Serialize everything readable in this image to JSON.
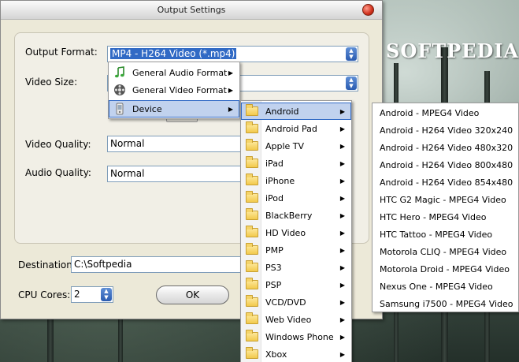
{
  "window": {
    "title": "Output Settings"
  },
  "watermark": {
    "brand": "SOFTPEDIA",
    "mark": "®"
  },
  "form": {
    "output_format_label": "Output Format:",
    "output_format_value": "MP4 - H264 Video (*.mp4)",
    "video_size_label": "Video Size:",
    "video_quality_label": "Video Quality:",
    "video_quality_value": "Normal",
    "audio_quality_label": "Audio Quality:",
    "audio_quality_value": "Normal",
    "destination_label": "Destination:",
    "destination_value": "C:\\Softpedia",
    "cpu_cores_label": "CPU Cores:",
    "cpu_cores_value": "2",
    "ok_label": "OK"
  },
  "menu_level1": [
    {
      "label": "General Audio Format",
      "icon": "music-note-icon"
    },
    {
      "label": "General Video Format",
      "icon": "film-reel-icon"
    },
    {
      "label": "Device",
      "icon": "device-icon"
    }
  ],
  "menu_level2": [
    "Android",
    "Android Pad",
    "Apple TV",
    "iPad",
    "iPhone",
    "iPod",
    "BlackBerry",
    "HD Video",
    "PMP",
    "PS3",
    "PSP",
    "VCD/DVD",
    "Web Video",
    "Windows Phone",
    "Xbox"
  ],
  "menu_level3": [
    "Android - MPEG4 Video",
    "Android - H264 Video 320x240",
    "Android - H264 Video 480x320",
    "Android - H264 Video 800x480",
    "Android - H264 Video 854x480",
    "HTC G2 Magic - MPEG4 Video",
    "HTC Hero - MPEG4 Video",
    "HTC Tattoo - MPEG4 Video",
    "Motorola CLIQ - MPEG4 Video",
    "Motorola Droid - MPEG4 Video",
    "Nexus One - MPEG4 Video",
    "Samsung i7500 - MPEG4 Video"
  ]
}
